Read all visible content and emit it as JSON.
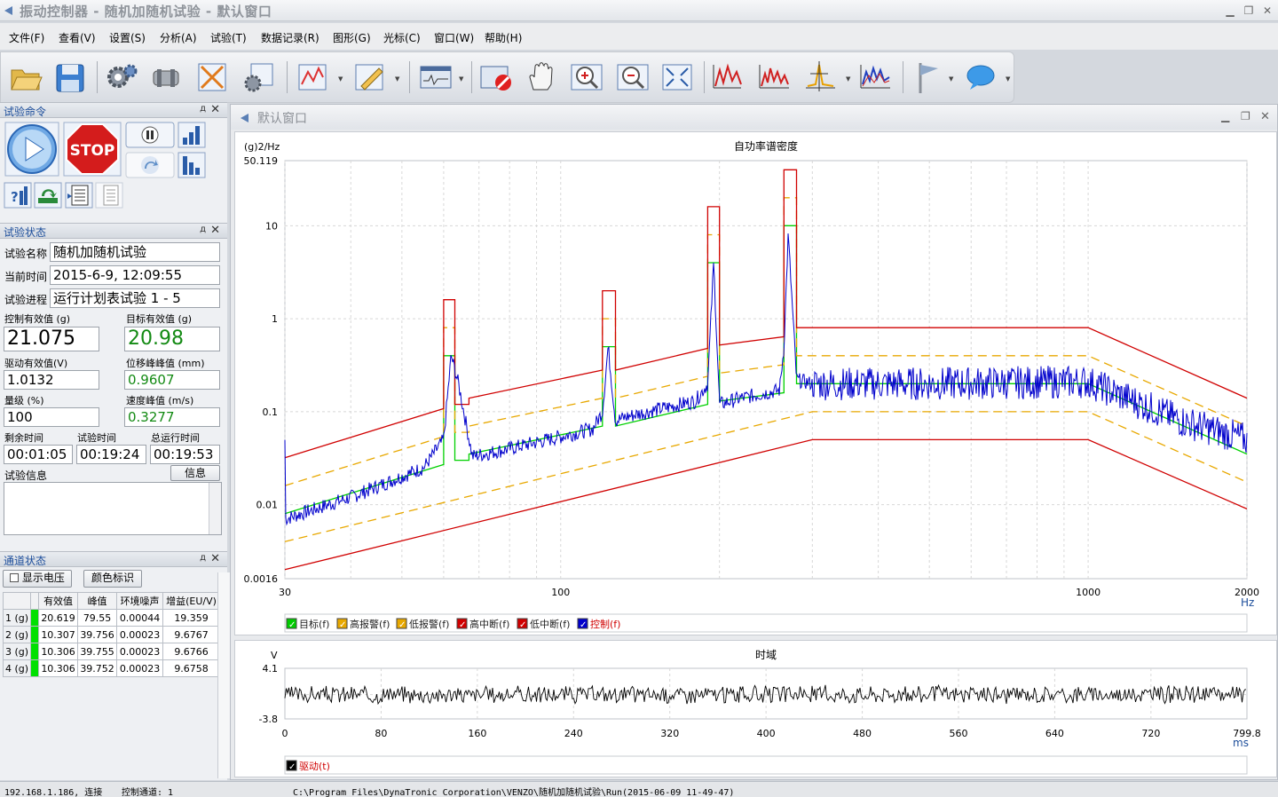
{
  "window": {
    "title": "振动控制器 - 随机加随机试验 - 默认窗口",
    "minimize": "▁",
    "restore": "❐",
    "close": "✕"
  },
  "menu": [
    "文件(F)",
    "查看(V)",
    "设置(S)",
    "分析(A)",
    "试验(T)",
    "数据记录(R)",
    "图形(G)",
    "光标(C)",
    "窗口(W)",
    "帮助(H)"
  ],
  "toolbar": {
    "icons": [
      "open-icon",
      "save-icon",
      "settings-icon",
      "cylinder-icon",
      "tools-icon",
      "gears-icon",
      "chart-edit-icon",
      "pencil-icon",
      "waveform-window-icon",
      "stop-record-icon",
      "hand-icon",
      "zoom-in-icon",
      "zoom-out-icon",
      "fit-icon",
      "spectrum-icon-1",
      "spectrum-icon-2",
      "peak-cursor-icon",
      "spectrum-icon-3",
      "flag-icon",
      "chat-icon"
    ]
  },
  "panels": {
    "commands": {
      "title": "试验命令",
      "pin": "д",
      "close": "✕",
      "stop": "STOP"
    },
    "status": {
      "title": "试验状态",
      "pin": "д",
      "close": "✕",
      "name_label": "试验名称",
      "name_value": "随机加随机试验",
      "time_label": "当前时间",
      "time_value": "2015-6-9, 12:09:55",
      "progress_label": "试验进程",
      "progress_value": "运行计划表试验 1 - 5",
      "ctrl_rms_label": "控制有效值 (g)",
      "ctrl_rms_value": "21.075",
      "target_rms_label": "目标有效值 (g)",
      "target_rms_value": "20.98",
      "drive_rms_label": "驱动有效值(V)",
      "drive_rms_value": "1.0132",
      "disp_label": "位移峰峰值 (mm)",
      "disp_value": "0.9607",
      "level_label": "量级 (%)",
      "level_value": "100",
      "vel_label": "速度峰值 (m/s)",
      "vel_value": "0.3277",
      "remain_label": "剩余时间",
      "remain_value": "00:01:05",
      "test_time_label": "试验时间",
      "test_time_value": "00:19:24",
      "total_label": "总运行时间",
      "total_value": "00:19:53",
      "info_label": "试验信息",
      "info_button": "信息"
    },
    "channels": {
      "title": "通道状态",
      "pin": "д",
      "close": "✕",
      "show_voltage": "显示电压",
      "color_tag": "颜色标识",
      "headers": [
        "",
        "有效值",
        "峰值",
        "环境噪声",
        "增益(EU/V)"
      ],
      "rows": [
        [
          "1 (g)",
          "20.619",
          "79.55",
          "0.00044",
          "19.359"
        ],
        [
          "2 (g)",
          "10.307",
          "39.756",
          "0.00023",
          "9.6767"
        ],
        [
          "3 (g)",
          "10.306",
          "39.755",
          "0.00023",
          "9.6766"
        ],
        [
          "4 (g)",
          "10.306",
          "39.752",
          "0.00023",
          "9.6758"
        ]
      ]
    }
  },
  "document": {
    "title": "默认窗口",
    "minimize": "▁",
    "restore": "❐",
    "close": "✕"
  },
  "chart_data": [
    {
      "type": "line",
      "title": "自功率谱密度",
      "ylabel": "(g)2/Hz",
      "xlabel": "Hz",
      "xscale": "log",
      "yscale": "log",
      "xlim": [
        30,
        2000
      ],
      "ylim": [
        0.0016,
        50.119
      ],
      "xticks": [
        "30",
        "100",
        "1000",
        "2000"
      ],
      "yticks": [
        "50.119",
        "10",
        "1",
        "0.1",
        "0.01",
        "0.0016"
      ],
      "grid": true,
      "legend_position": "bottom",
      "legend": [
        {
          "label": "目标(f)",
          "color": "#00cc00"
        },
        {
          "label": "高报警(f)",
          "color": "#e8a800"
        },
        {
          "label": "低报警(f)",
          "color": "#e8a800"
        },
        {
          "label": "高中断(f)",
          "color": "#d00000"
        },
        {
          "label": "低中断(f)",
          "color": "#d00000"
        },
        {
          "label": "控制(f)",
          "color": "#0000cc"
        }
      ],
      "series": [
        {
          "name": "目标(f)",
          "x": [
            30,
            60,
            60,
            63,
            63,
            67,
            67,
            120,
            120,
            127,
            127,
            190,
            190,
            200,
            200,
            265,
            265,
            280,
            280,
            300,
            1000,
            2000
          ],
          "y": [
            0.008,
            0.027,
            0.4,
            0.4,
            0.03,
            0.03,
            0.035,
            0.07,
            0.5,
            0.5,
            0.07,
            0.12,
            4,
            4,
            0.13,
            0.16,
            10,
            10,
            0.2,
            0.2,
            0.2,
            0.035
          ]
        },
        {
          "name": "高报警(f)",
          "x": [
            30,
            60,
            60,
            63,
            63,
            67,
            67,
            120,
            120,
            127,
            127,
            190,
            190,
            200,
            200,
            265,
            265,
            280,
            280,
            300,
            1000,
            2000
          ],
          "y": [
            0.016,
            0.054,
            0.8,
            0.8,
            0.06,
            0.06,
            0.07,
            0.14,
            1.0,
            1.0,
            0.14,
            0.24,
            8,
            8,
            0.26,
            0.32,
            20,
            20,
            0.4,
            0.4,
            0.4,
            0.07
          ]
        },
        {
          "name": "低报警(f)",
          "x": [
            30,
            300,
            1000,
            2000
          ],
          "y": [
            0.004,
            0.1,
            0.1,
            0.0175
          ]
        },
        {
          "name": "高中断(f)",
          "x": [
            30,
            60,
            60,
            63,
            63,
            67,
            67,
            120,
            120,
            127,
            127,
            190,
            190,
            200,
            200,
            265,
            265,
            280,
            280,
            300,
            1000,
            2000
          ],
          "y": [
            0.032,
            0.108,
            1.6,
            1.6,
            0.12,
            0.12,
            0.14,
            0.28,
            2.0,
            2.0,
            0.28,
            0.48,
            16,
            16,
            0.52,
            0.64,
            40,
            40,
            0.8,
            0.8,
            0.8,
            0.14
          ]
        },
        {
          "name": "低中断(f)",
          "x": [
            30,
            300,
            1000,
            2000
          ],
          "y": [
            0.002,
            0.05,
            0.05,
            0.009
          ]
        },
        {
          "name": "控制(f)",
          "x": [
            30,
            40,
            55,
            60,
            62,
            64,
            68,
            80,
            115,
            120,
            123,
            127,
            135,
            180,
            190,
            195,
            200,
            220,
            260,
            265,
            270,
            280,
            300,
            500,
            1000,
            1500,
            2000
          ],
          "y": [
            0.007,
            0.012,
            0.025,
            0.05,
            0.4,
            0.2,
            0.033,
            0.04,
            0.065,
            0.1,
            0.5,
            0.08,
            0.09,
            0.13,
            0.2,
            4,
            0.12,
            0.14,
            0.17,
            0.5,
            8,
            0.22,
            0.2,
            0.2,
            0.21,
            0.08,
            0.05
          ]
        }
      ]
    },
    {
      "type": "line",
      "title": "时域",
      "ylabel": "V",
      "xlabel": "ms",
      "xlim": [
        0,
        799.8
      ],
      "ylim": [
        -3.8,
        4.1
      ],
      "xticks": [
        "0",
        "80",
        "160",
        "240",
        "320",
        "400",
        "480",
        "560",
        "640",
        "720",
        "799.8"
      ],
      "yticks": [
        "4.1",
        "-3.8"
      ],
      "grid": true,
      "legend_position": "bottom",
      "legend": [
        {
          "label": "驱动(t)",
          "color": "#000000"
        }
      ],
      "series": [
        {
          "name": "驱动(t)",
          "description_range": [
            -1.1,
            1.1
          ]
        }
      ]
    }
  ],
  "statusbar": {
    "ip": "192.168.1.186, 连接",
    "channel": "控制通道: 1",
    "path": "C:\\Program Files\\DynaTronic Corporation\\VENZO\\随机加随机试验\\Run(2015-06-09 11-49-47)"
  }
}
